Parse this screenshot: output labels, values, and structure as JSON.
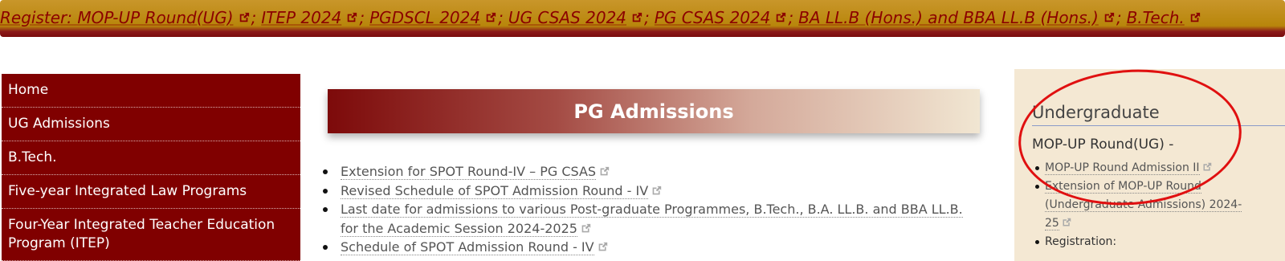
{
  "marquee": {
    "items": [
      "Register: MOP-UP Round(UG)",
      "ITEP 2024",
      "PGDSCL 2024",
      "UG CSAS 2024",
      "PG CSAS 2024",
      "BA LL.B (Hons.) and BBA LL.B (Hons.)",
      "B.Tech."
    ],
    "separator": ";"
  },
  "sidebar": {
    "items": [
      "Home",
      "UG Admissions",
      "B.Tech.",
      "Five-year Integrated Law Programs",
      "Four-Year Integrated Teacher Education Program (ITEP)"
    ]
  },
  "main": {
    "banner_title": "PG Admissions",
    "links": [
      "Extension for SPOT Round-IV – PG CSAS",
      "Revised Schedule of SPOT Admission Round - IV",
      "Last date for admissions to various Post-graduate Programmes, B.Tech., B.A. LL.B. and BBA LL.B. for the Academic Session 2024-2025",
      "Schedule of SPOT Admission Round - IV"
    ]
  },
  "right_panel": {
    "heading": "Undergraduate",
    "subheading": "MOP-UP Round(UG) -",
    "links": [
      "MOP-UP Round Admission II",
      "Extension of MOP-UP Round (Undergraduate Admissions) 2024-25",
      "Registration:"
    ]
  },
  "colors": {
    "marquee_gold": "#b8860b",
    "marquee_text": "#8b0000",
    "sidebar_bg": "#800000",
    "right_panel_bg": "#f4e8d3",
    "annotation_circle": "#e01010"
  },
  "icons": {
    "external_link": "external-link-icon"
  }
}
